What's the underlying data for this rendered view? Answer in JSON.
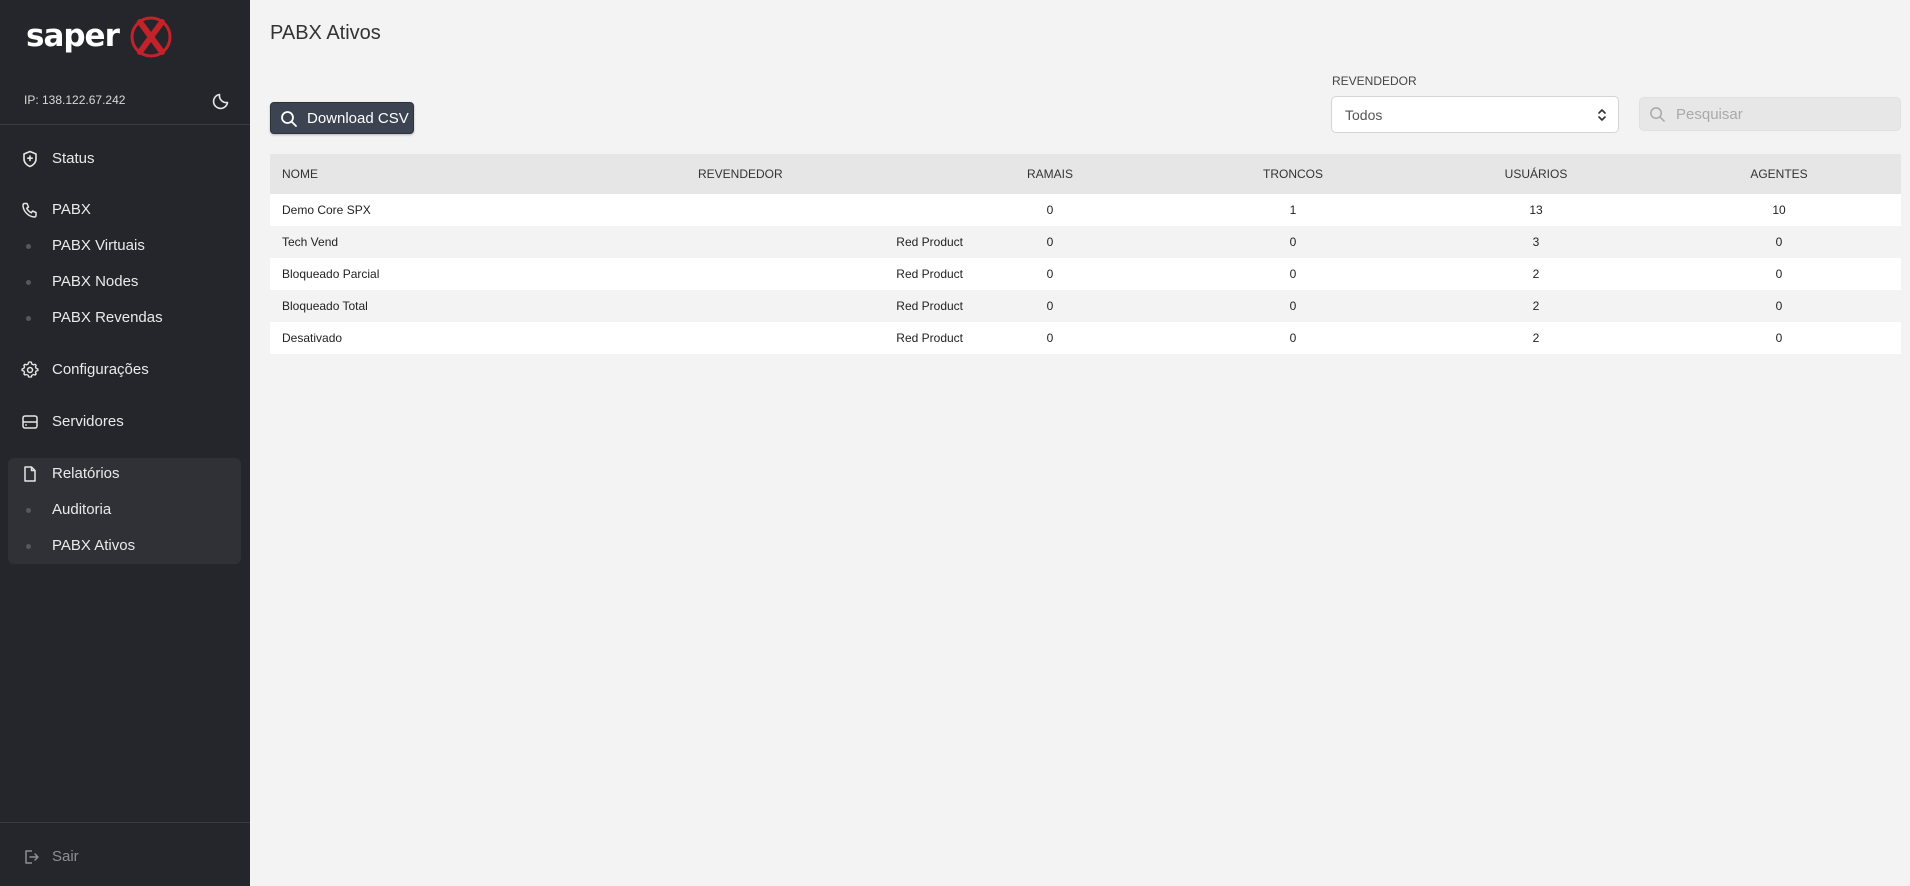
{
  "sidebar": {
    "logo_text": "saper",
    "ip": "IP: 138.122.67.242",
    "nav": {
      "status": "Status",
      "pabx": "PABX",
      "pabx_virtuais": "PABX Virtuais",
      "pabx_nodes": "PABX Nodes",
      "pabx_revendas": "PABX Revendas",
      "configuracoes": "Configurações",
      "servidores": "Servidores",
      "relatorios": "Relatórios",
      "auditoria": "Auditoria",
      "pabx_ativos": "PABX Ativos"
    },
    "logout": "Sair"
  },
  "main": {
    "title": "PABX Ativos",
    "download_csv": "Download CSV",
    "filter": {
      "label": "REVENDEDOR",
      "value": "Todos"
    },
    "search": {
      "placeholder": "Pesquisar"
    },
    "table": {
      "headers": {
        "nome": "NOME",
        "revendedor": "REVENDEDOR",
        "ramais": "RAMAIS",
        "troncos": "TRONCOS",
        "usuarios": "USUÁRIOS",
        "agentes": "AGENTES"
      },
      "rows": [
        {
          "nome": "Demo Core SPX",
          "revendedor": "",
          "ramais": "0",
          "troncos": "1",
          "usuarios": "13",
          "agentes": "10"
        },
        {
          "nome": "Tech Vend",
          "revendedor": "Red Product",
          "ramais": "0",
          "troncos": "0",
          "usuarios": "3",
          "agentes": "0"
        },
        {
          "nome": "Bloqueado Parcial",
          "revendedor": "Red Product",
          "ramais": "0",
          "troncos": "0",
          "usuarios": "2",
          "agentes": "0"
        },
        {
          "nome": "Bloqueado Total",
          "revendedor": "Red Product",
          "ramais": "0",
          "troncos": "0",
          "usuarios": "2",
          "agentes": "0"
        },
        {
          "nome": "Desativado",
          "revendedor": "Red Product",
          "ramais": "0",
          "troncos": "0",
          "usuarios": "2",
          "agentes": "0"
        }
      ]
    }
  },
  "colors": {
    "sidebar_bg": "#24262b",
    "brand_red": "#c4222a",
    "button_bg": "#3c4351"
  }
}
